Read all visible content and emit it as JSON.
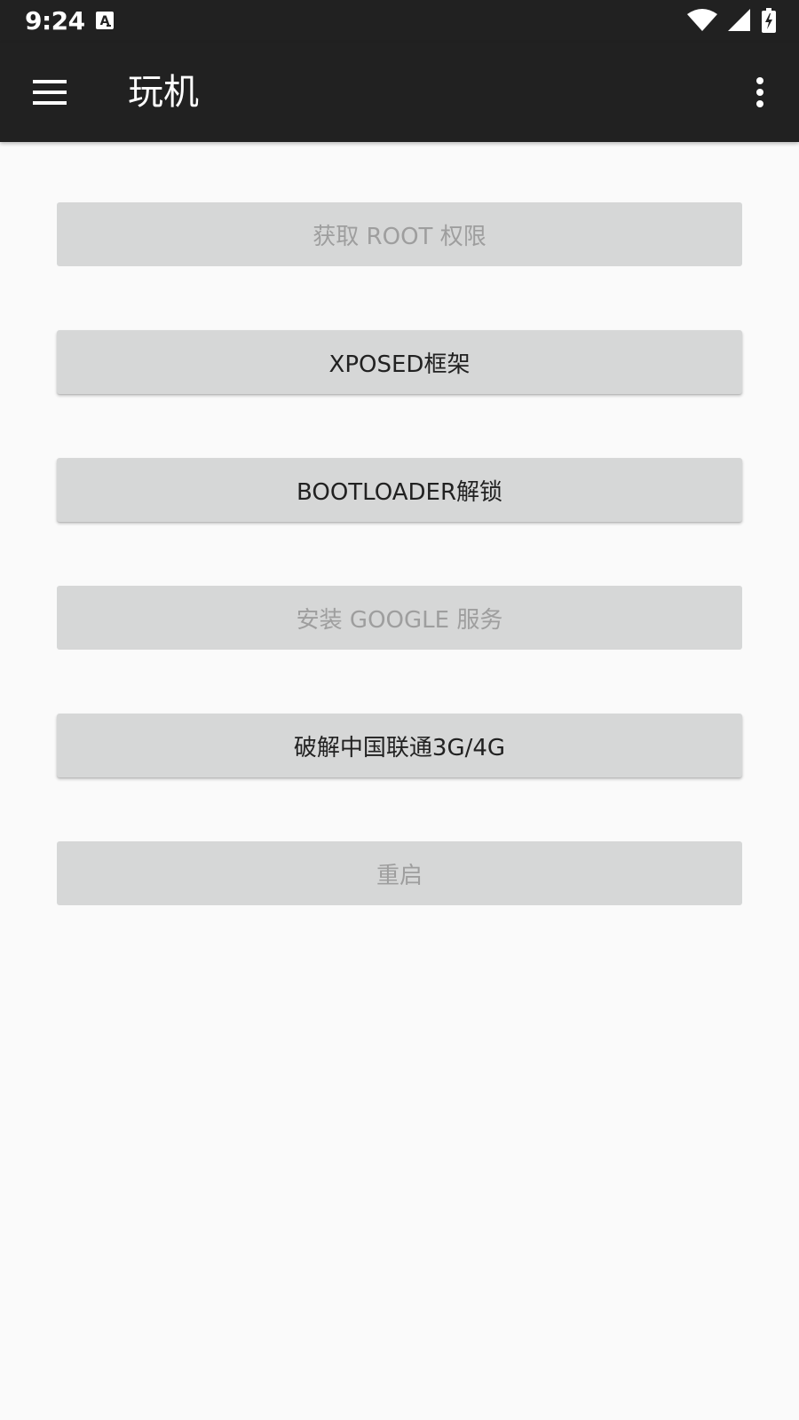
{
  "status_bar": {
    "time": "9:24",
    "icons": [
      "notification-a-icon",
      "wifi-icon",
      "cell-signal-icon",
      "battery-charging-icon"
    ]
  },
  "app_bar": {
    "title": "玩机",
    "menu_icon": "hamburger-menu-icon",
    "overflow_icon": "more-vert-icon"
  },
  "buttons": [
    {
      "label": "获取 ROOT 权限",
      "enabled": false
    },
    {
      "label": "XPOSED框架",
      "enabled": true
    },
    {
      "label": "BOOTLOADER解锁",
      "enabled": true
    },
    {
      "label": "安装 GOOGLE 服务",
      "enabled": false
    },
    {
      "label": "破解中国联通3G/4G",
      "enabled": true
    },
    {
      "label": "重启",
      "enabled": false
    }
  ],
  "colors": {
    "app_bar": "#212121",
    "background": "#fafafa",
    "button": "#d6d7d7",
    "text_enabled": "#212121",
    "text_disabled": "#9e9e9e"
  }
}
